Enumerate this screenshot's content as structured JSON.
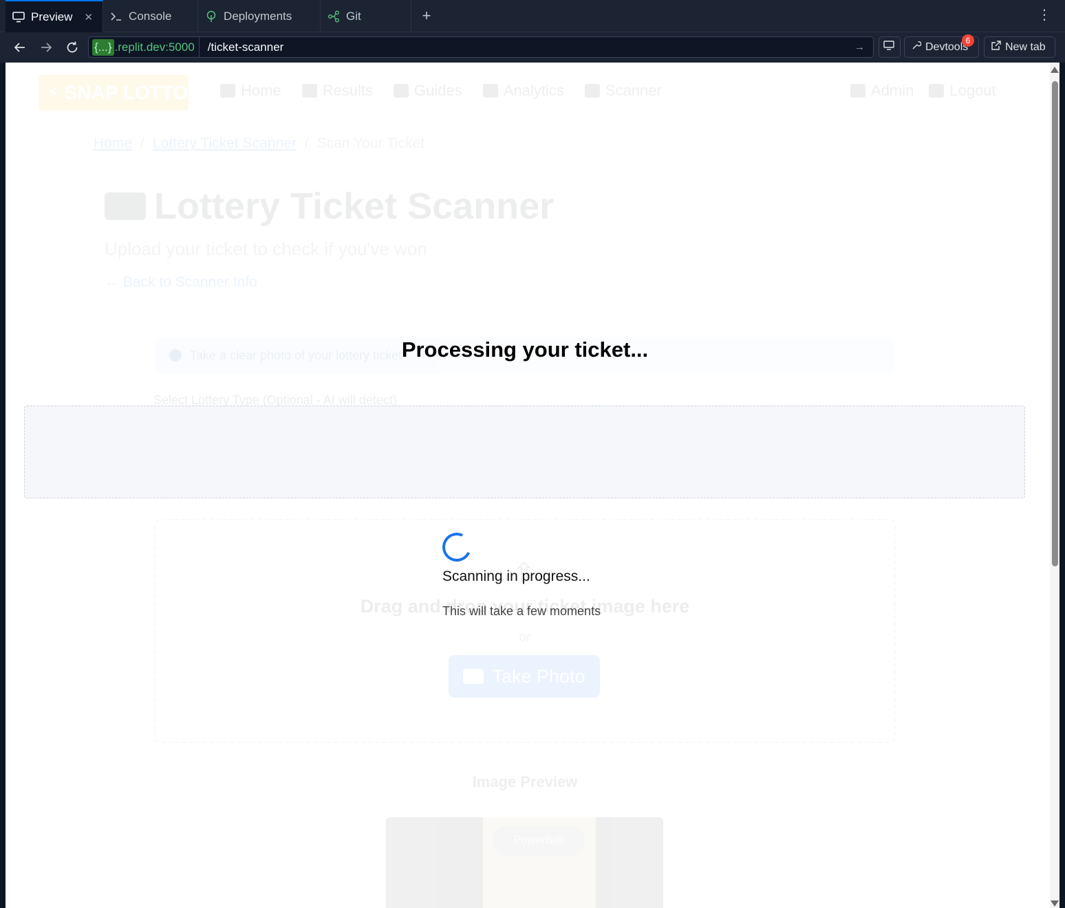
{
  "ide": {
    "tabs": [
      {
        "label": "Preview",
        "icon": "monitor-icon",
        "active": true
      },
      {
        "label": "Console",
        "icon": "terminal-icon",
        "active": false
      },
      {
        "label": "Deployments",
        "icon": "deploy-icon",
        "active": false
      },
      {
        "label": "Git",
        "icon": "git-icon",
        "active": false
      }
    ],
    "address": {
      "host_badge": "{...}",
      "host_rest": ".replit.dev:5000",
      "path": "/ticket-scanner"
    },
    "devtools_label": "Devtools",
    "devtools_count": "6",
    "newtab_label": "New tab"
  },
  "page": {
    "brand": "SNAP LOTTO",
    "nav": [
      "Home",
      "Results",
      "Guides",
      "Analytics",
      "Scanner"
    ],
    "nav_right": [
      "Admin",
      "Logout"
    ],
    "breadcrumb": {
      "home": "Home",
      "section": "Lottery Ticket Scanner",
      "current": "Scan Your Ticket",
      "separator": "/"
    },
    "title": "Lottery Ticket Scanner",
    "subtitle": "Upload your ticket to check if you've won",
    "back_link": "Back to Scanner Info",
    "info_text": "Take a clear photo of your lottery ticket",
    "select_label": "Select Lottery Type (Optional - AI will detect)",
    "dropzone_text": "Drag and drop your ticket image here",
    "dropzone_or": "or",
    "take_photo": "Take Photo",
    "image_preview_title": "Image Preview",
    "ticket_logo": "PowerBall"
  },
  "overlay": {
    "title": "Processing your ticket...",
    "scanning": "Scanning in progress...",
    "subtext": "This will take a few moments"
  },
  "colors": {
    "accent": "#0079f2",
    "brand": "#ffc107",
    "spinner": "#1a73e8",
    "badge": "#f44336"
  }
}
